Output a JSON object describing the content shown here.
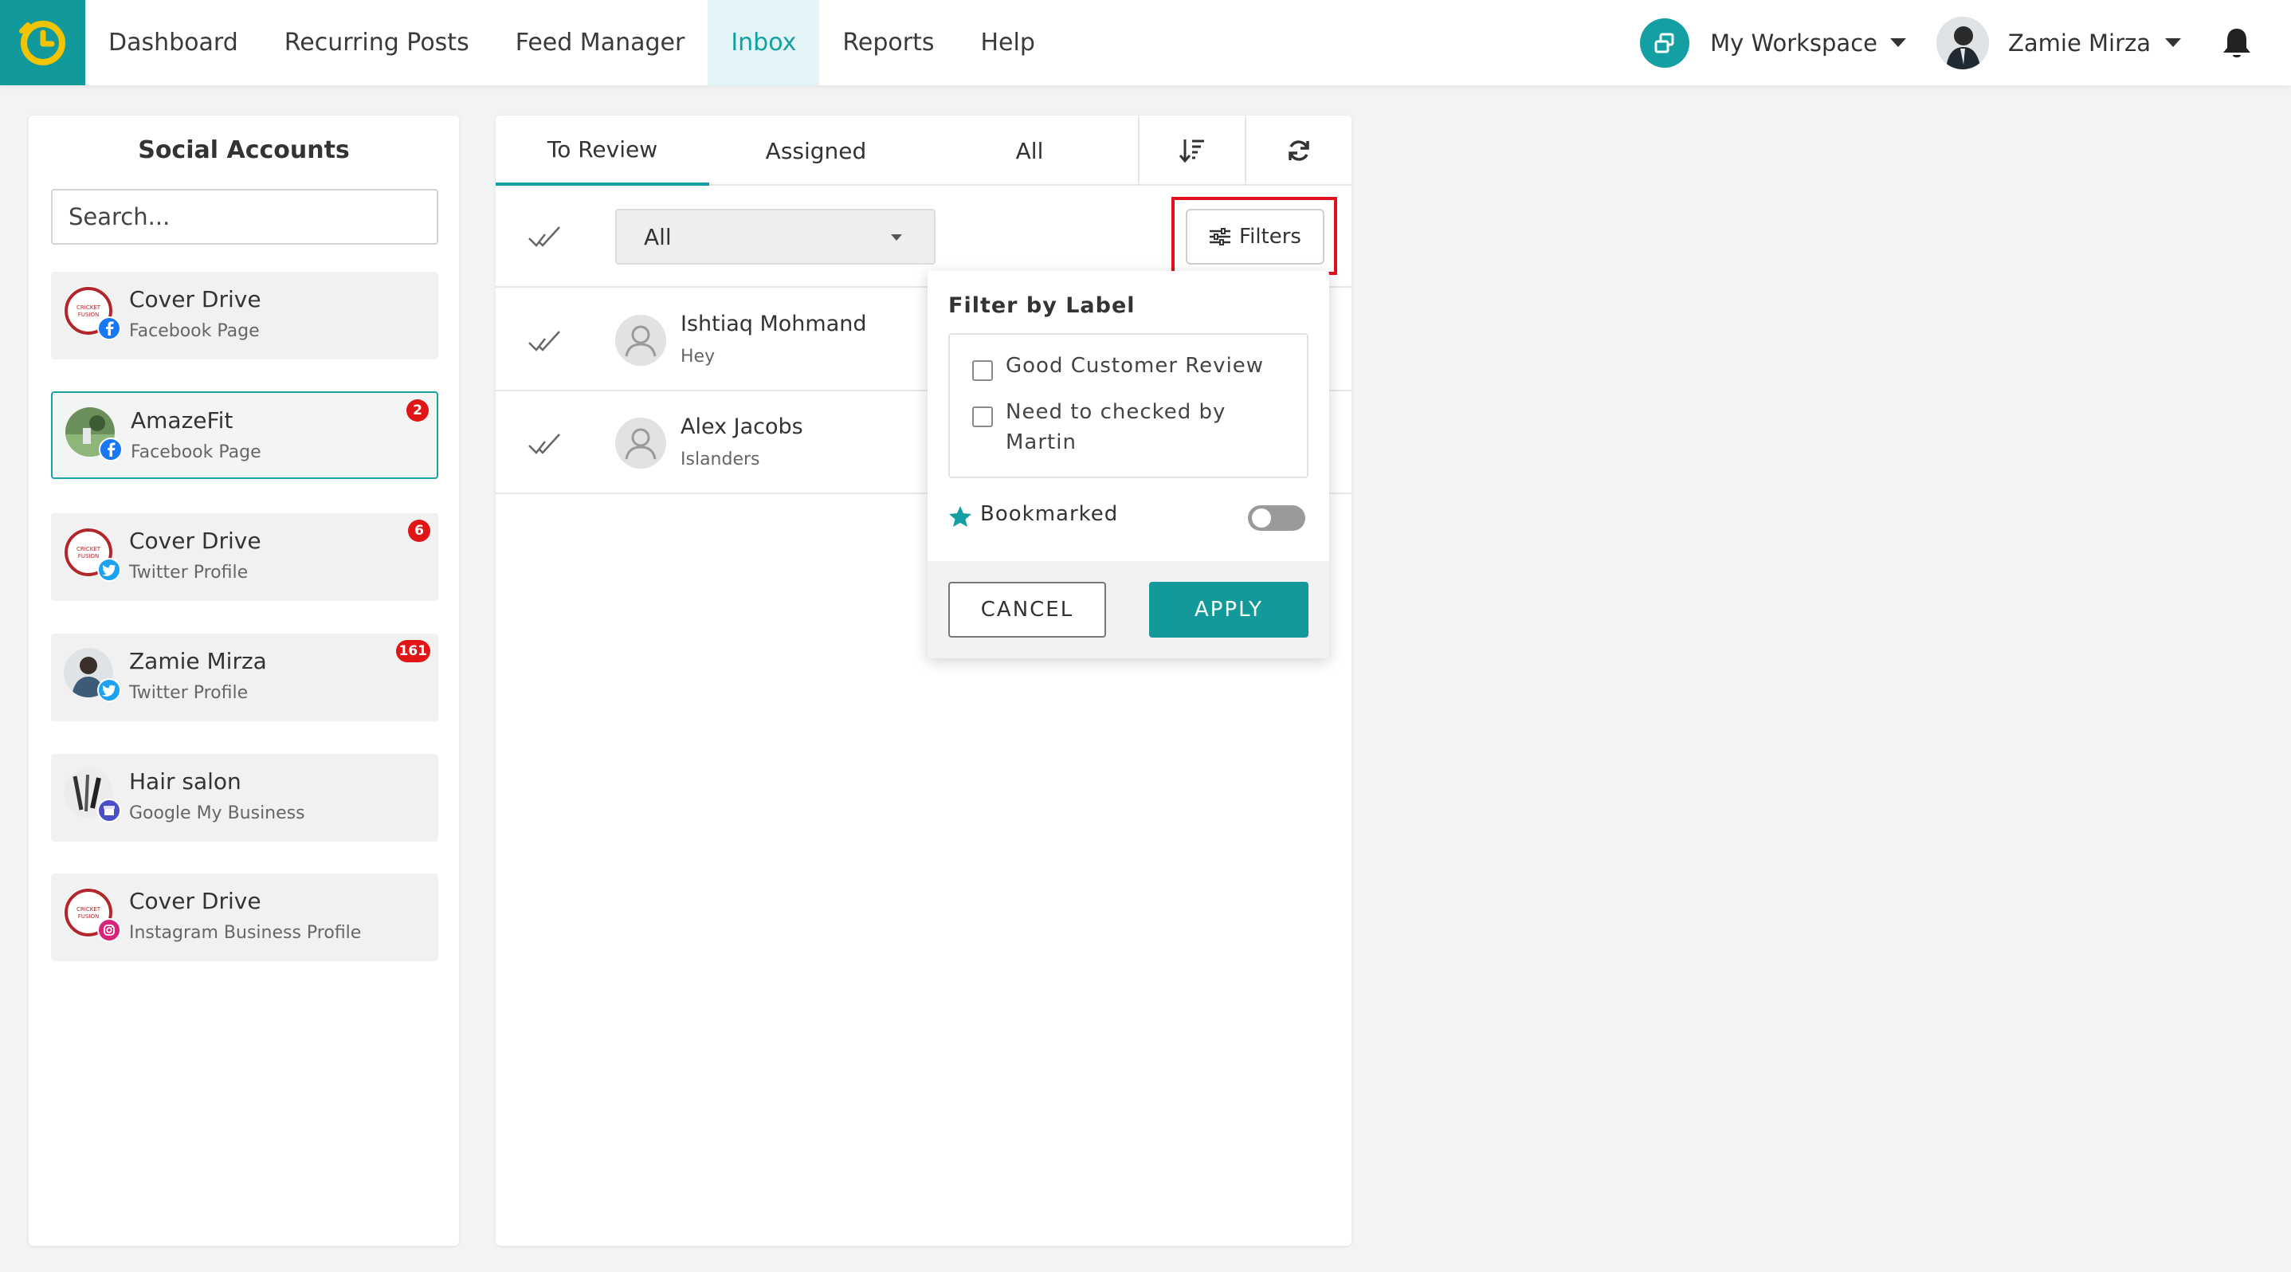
{
  "nav": {
    "items": [
      {
        "label": "Dashboard"
      },
      {
        "label": "Recurring Posts"
      },
      {
        "label": "Feed Manager"
      },
      {
        "label": "Inbox",
        "active": true
      },
      {
        "label": "Reports"
      },
      {
        "label": "Help"
      }
    ],
    "workspace": "My Workspace",
    "user": "Zamie Mirza",
    "accent": "#12999b"
  },
  "sidebar": {
    "title": "Social Accounts",
    "search_placeholder": "Search...",
    "accounts": [
      {
        "name": "Cover Drive",
        "type": "Facebook Page",
        "network": "facebook-icon",
        "badge": ""
      },
      {
        "name": "AmazeFit",
        "type": "Facebook Page",
        "network": "facebook-icon",
        "badge": "2",
        "selected": true
      },
      {
        "name": "Cover Drive",
        "type": "Twitter Profile",
        "network": "twitter-icon",
        "badge": "6"
      },
      {
        "name": "Zamie Mirza",
        "type": "Twitter Profile",
        "network": "twitter-icon",
        "badge": "161"
      },
      {
        "name": "Hair salon",
        "type": "Google My Business",
        "network": "google-my-business-icon",
        "badge": ""
      },
      {
        "name": "Cover Drive",
        "type": "Instagram Business Profile",
        "network": "instagram-icon",
        "badge": ""
      }
    ]
  },
  "inbox": {
    "tabs": [
      {
        "label": "To Review",
        "active": true
      },
      {
        "label": "Assigned"
      },
      {
        "label": "All"
      }
    ],
    "select_value": "All",
    "filters_label": "Filters",
    "messages": [
      {
        "name": "Ishtiaq Mohmand",
        "text": "Hey"
      },
      {
        "name": "Alex Jacobs",
        "text": "Islanders"
      }
    ]
  },
  "filter_popup": {
    "title": "Filter by Label",
    "labels": [
      {
        "label": "Good Customer Review",
        "checked": false
      },
      {
        "label": "Need to checked by Martin",
        "checked": false
      }
    ],
    "bookmarked_label": "Bookmarked",
    "bookmarked_on": false,
    "cancel_label": "CANCEL",
    "apply_label": "APPLY"
  },
  "colors": {
    "teal": "#14a0a3",
    "badge_red": "#e01616",
    "highlight_red": "#e0101c",
    "facebook": "#1877f2",
    "twitter": "#1da1f2",
    "gmb": "#4a4fc9",
    "instagram": "#d6247b"
  }
}
